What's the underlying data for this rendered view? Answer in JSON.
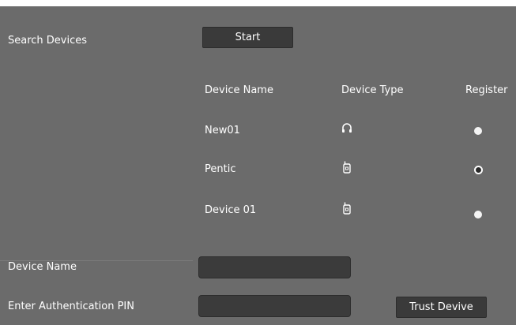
{
  "search": {
    "label": "Search Devices",
    "start_button": "Start"
  },
  "table": {
    "columns": [
      "Device Name",
      "Device Type",
      "Register"
    ],
    "rows": [
      {
        "name": "New01",
        "type_icon": "headset-icon",
        "registered": false
      },
      {
        "name": "Pentic",
        "type_icon": "handset-icon",
        "registered": true
      },
      {
        "name": "Device 01",
        "type_icon": "handset-icon",
        "registered": false
      }
    ]
  },
  "form": {
    "device_name_label": "Device Name",
    "device_name_value": "",
    "pin_label": "Enter Authentication PIN",
    "pin_value": "",
    "trust_button": "Trust Devive"
  },
  "colors": {
    "panel": "#6b6b6b",
    "button": "#3a3a3a",
    "input": "#3b3b3b",
    "text": "#ffffff"
  }
}
